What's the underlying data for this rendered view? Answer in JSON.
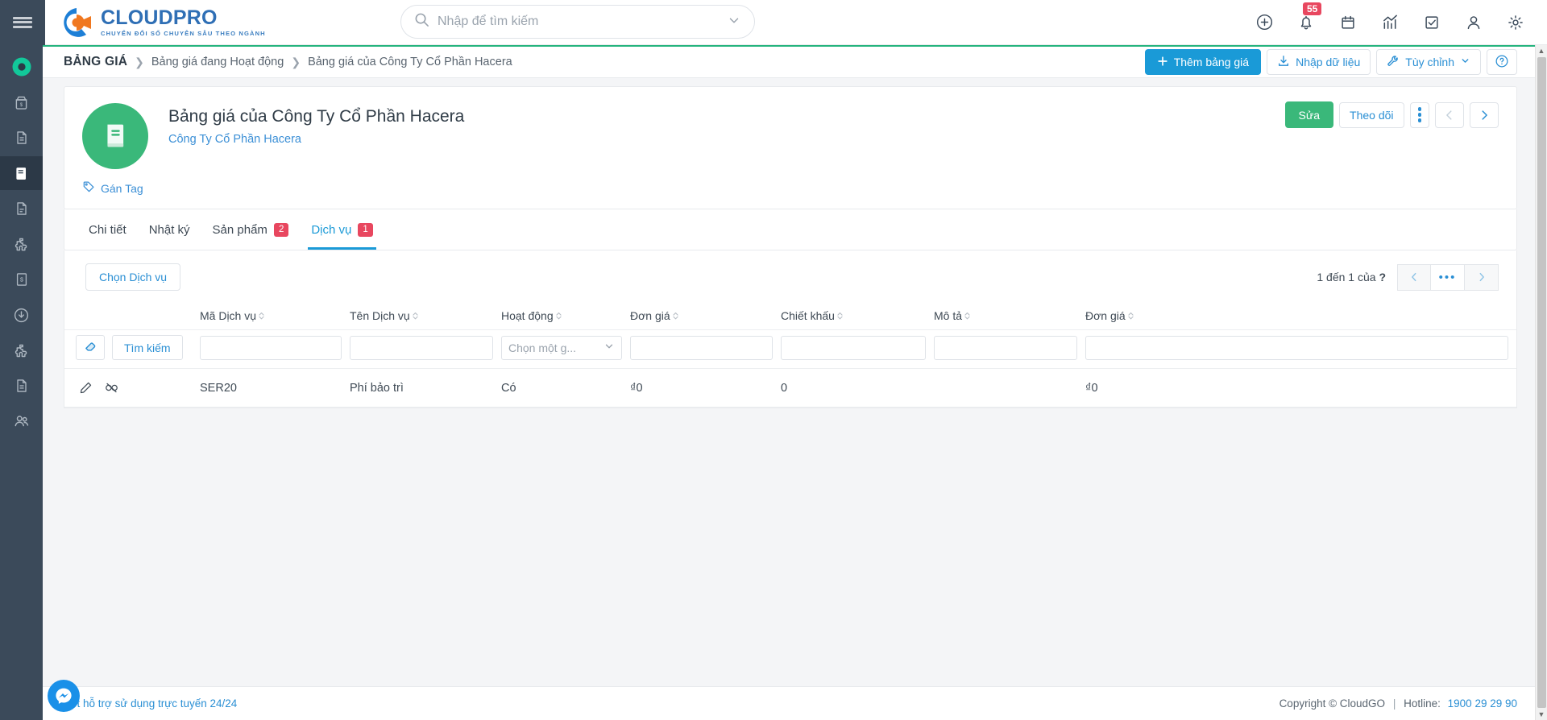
{
  "brand": {
    "name": "CLOUDPRO",
    "tagline": "CHUYỂN ĐỔI SỐ CHUYÊN SÂU THEO NGÀNH"
  },
  "search": {
    "placeholder": "Nhập để tìm kiếm",
    "value": ""
  },
  "topbar": {
    "icons": [
      {
        "name": "add-circle-icon",
        "label": ""
      },
      {
        "name": "bell-icon",
        "label": "",
        "badge": "55"
      },
      {
        "name": "calendar-icon",
        "label": ""
      },
      {
        "name": "analytics-icon",
        "label": ""
      },
      {
        "name": "task-checkbox-icon",
        "label": ""
      },
      {
        "name": "user-icon",
        "label": ""
      },
      {
        "name": "gear-icon",
        "label": ""
      }
    ]
  },
  "breadcrumb": {
    "title": "BẢNG GIÁ",
    "separator": "❯",
    "items": [
      {
        "label": "Bảng giá đang Hoạt động"
      },
      {
        "label": "Bảng giá của Công Ty Cổ Phần Hacera"
      }
    ],
    "actions": {
      "add": "Thêm bảng giá",
      "import": "Nhập dữ liệu",
      "customize": "Tùy chỉnh",
      "help": "?"
    }
  },
  "record": {
    "title": "Bảng giá của Công Ty Cổ Phần Hacera",
    "subtitle": "Công Ty Cổ Phần Hacera",
    "tag_label": "Gán Tag",
    "actions": {
      "edit": "Sửa",
      "follow": "Theo dõi"
    }
  },
  "tabs": [
    {
      "label": "Chi tiết",
      "badge": "",
      "active": false
    },
    {
      "label": "Nhật ký",
      "badge": "",
      "active": false
    },
    {
      "label": "Sản phẩm",
      "badge": "2",
      "active": false
    },
    {
      "label": "Dịch vụ",
      "badge": "1",
      "active": true
    }
  ],
  "panel": {
    "select_button": "Chọn Dịch vụ",
    "pager": {
      "range_prefix": "1 đến 1 của",
      "total": "?",
      "more": "•••"
    },
    "filter": {
      "search_button": "Tìm kiếm",
      "select_placeholder": "Chọn một g...",
      "values": [
        "",
        "",
        "",
        "",
        "",
        ""
      ]
    },
    "columns": [
      {
        "label": "Mã Dịch vụ",
        "sortable": true
      },
      {
        "label": "Tên Dịch vụ",
        "sortable": true
      },
      {
        "label": "Hoạt động",
        "sortable": true
      },
      {
        "label": "Đơn giá",
        "sortable": true
      },
      {
        "label": "Chiết khấu",
        "sortable": true
      },
      {
        "label": "Mô tả",
        "sortable": true
      },
      {
        "label": "Đơn giá",
        "sortable": true
      }
    ],
    "rows": [
      {
        "code": "SER20",
        "name": "Phí bảo trì",
        "active": "Có",
        "unit_price": "₫0",
        "discount": "0",
        "description": "",
        "total_price": "₫0"
      }
    ]
  },
  "footer": {
    "support": "Bot hỗ trợ sử dụng trực tuyến 24/24",
    "copyright": "Copyright © CloudGO",
    "hotline_label": "Hotline:",
    "hotline": "1900 29 29 90"
  },
  "colors": {
    "accent_blue": "#1a9ad7",
    "green": "#3ab87a",
    "badge_red": "#e8475f",
    "sidebar_dark": "#3b4a5a",
    "topbar_accent": "#25b47e"
  }
}
